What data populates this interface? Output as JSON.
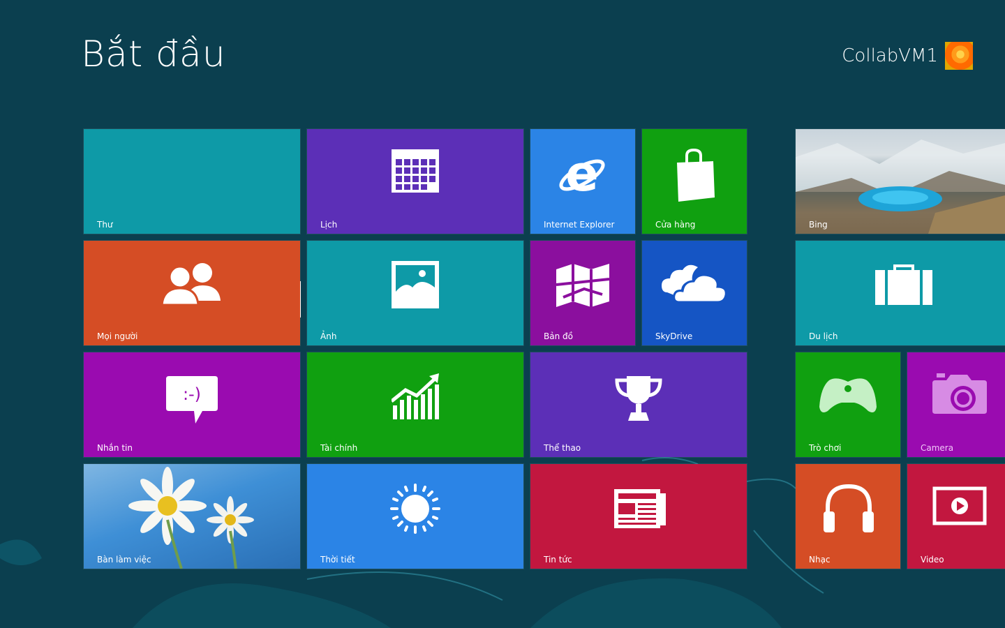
{
  "header": {
    "title": "Bắt đầu",
    "username": "CollabVM1"
  },
  "tiles": {
    "mail": {
      "label": "Thư",
      "color": "#0e9aa7"
    },
    "calendar": {
      "label": "Lịch",
      "color": "#5c2fb7"
    },
    "ie": {
      "label": "Internet Explorer",
      "color": "#2b84e6"
    },
    "store": {
      "label": "Cửa hàng",
      "color": "#10a010"
    },
    "bing": {
      "label": "Bing",
      "color": "#6d8fa0"
    },
    "people": {
      "label": "Mọi người",
      "color": "#d54d25"
    },
    "photos": {
      "label": "Ảnh",
      "color": "#0e9aa7"
    },
    "maps": {
      "label": "Bản đồ",
      "color": "#8b0f9e"
    },
    "skydrive": {
      "label": "SkyDrive",
      "color": "#1555c4"
    },
    "travel": {
      "label": "Du lịch",
      "color": "#0e9aa7"
    },
    "messaging": {
      "label": "Nhắn tin",
      "color": "#9a0bb0"
    },
    "finance": {
      "label": "Tài chính",
      "color": "#10a010"
    },
    "sports": {
      "label": "Thể thao",
      "color": "#5c2fb7"
    },
    "games": {
      "label": "Trò chơi",
      "color": "#10a010"
    },
    "camera": {
      "label": "Camera",
      "color": "#9a0bb0"
    },
    "desktop": {
      "label": "Bàn làm việc",
      "color": "#3e8fd6"
    },
    "weather": {
      "label": "Thời tiết",
      "color": "#2b84e6"
    },
    "news": {
      "label": "Tin tức",
      "color": "#c2173f"
    },
    "music": {
      "label": "Nhạc",
      "color": "#d54d25"
    },
    "video": {
      "label": "Video",
      "color": "#c2173f"
    }
  }
}
